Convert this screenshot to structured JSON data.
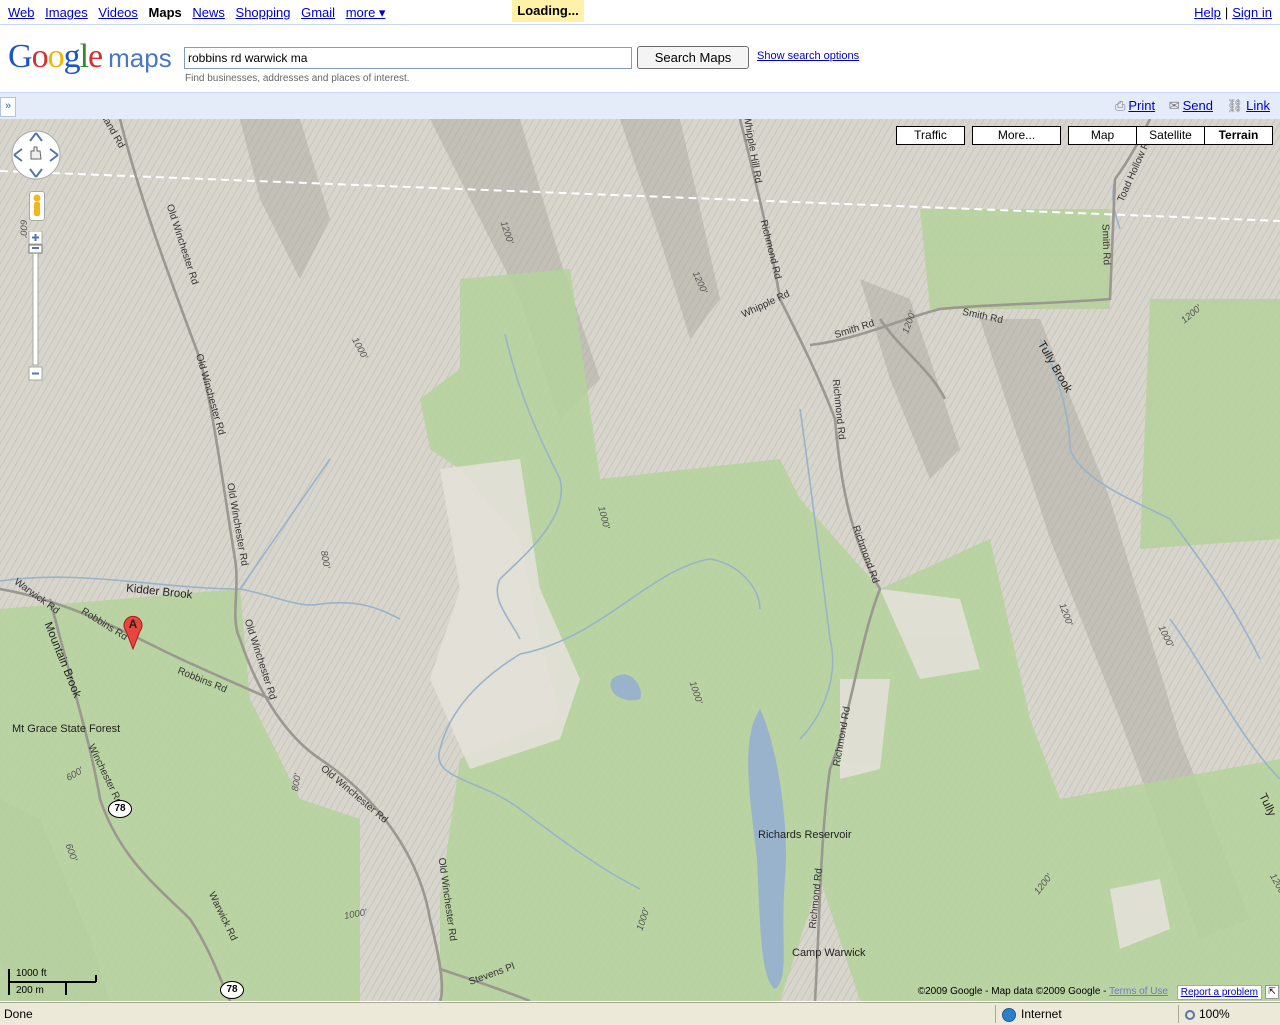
{
  "gbar": {
    "links": [
      "Web",
      "Images",
      "Videos",
      "Maps",
      "News",
      "Shopping",
      "Gmail",
      "more ▾"
    ],
    "current": "Maps",
    "help": "Help",
    "sign_in": "Sign in",
    "separator": "|"
  },
  "loading": "Loading...",
  "header": {
    "logo_google": [
      "G",
      "o",
      "o",
      "g",
      "l",
      "e"
    ],
    "logo_maps": "maps",
    "search_value": "robbins rd warwick ma",
    "search_button": "Search Maps",
    "search_options": "Show search options",
    "hint": "Find businesses, addresses and places of interest."
  },
  "toolbar": {
    "panel_toggle": "»",
    "print": "Print",
    "send": "Send",
    "link": "Link"
  },
  "map": {
    "type_buttons": {
      "traffic": "Traffic",
      "more": "More...",
      "map": "Map",
      "satellite": "Satellite",
      "terrain": "Terrain",
      "selected": "Terrain"
    },
    "marker": "A",
    "road_labels": {
      "land_rd": "land Rd",
      "old_winchester_1": "Old Winchester Rd",
      "old_winchester_2": "Old Winchester Rd",
      "old_winchester_3": "Old Winchester Rd",
      "old_winchester_4": "Old Winchester Rd",
      "old_winchester_5": "Old Winchester Rd",
      "old_winchester_6": "Old Winchester Rd",
      "whipple_hill": "Whipple Hill Rd",
      "whipple": "Whipple Rd",
      "richmond_1": "Richmond Rd",
      "richmond_2": "Richmond Rd",
      "richmond_3": "Richmond Rd",
      "richmond_4": "Richmond Rd",
      "richmond_5": "Richmond Rd",
      "smith_1": "Smith Rd",
      "smith_2": "Smith Rd",
      "smith_3": "Smith Rd",
      "toad_hollow": "Toad Hollow Rd",
      "warwick_1": "Warwick Rd",
      "warwick_2": "Warwick Rd",
      "robbins_1": "Robbins Rd",
      "robbins_2": "Robbins Rd",
      "winchester": "Winchester Rd",
      "stevens": "Stevens Pl"
    },
    "water_labels": {
      "kidder": "Kidder Brook",
      "mountain": "Mountain Brook",
      "tully_1": "Tully Brook",
      "tully_2": "Tully",
      "richards": "Richards Reservoir"
    },
    "place_labels": {
      "mt_grace": "Mt Grace State Forest",
      "camp": "Camp Warwick"
    },
    "elevation_labels": [
      "600'",
      "1200'",
      "1200'",
      "1000'",
      "1000'",
      "800'",
      "1000'",
      "1200'",
      "1200'",
      "1200'",
      "1000'",
      "1200'",
      "600'",
      "600'",
      "800'",
      "1000'",
      "1000'",
      "1200'"
    ],
    "route_shields": [
      "78",
      "78"
    ],
    "scale": {
      "feet": "1000 ft",
      "meters": "200 m"
    },
    "copyright": "©2009 Google - Map data ©2009 Google - ",
    "terms": "Terms of Use",
    "report": "Report a problem"
  },
  "statusbar": {
    "done": "Done",
    "zone": "Internet",
    "zoom": "100%"
  },
  "colors": {
    "terrain_base": "#dddbd2",
    "forest_green": "#b5d29b",
    "water": "#99b3cc",
    "toolbar_bg": "#e5ecf9",
    "loading_bg": "#fff1a8",
    "marker_red": "#e8463c"
  }
}
